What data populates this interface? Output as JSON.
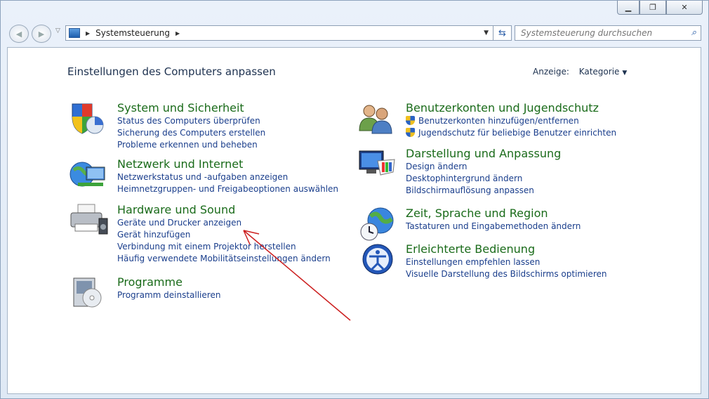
{
  "address": {
    "path_item": "Systemsteuerung"
  },
  "search": {
    "placeholder": "Systemsteuerung durchsuchen"
  },
  "header": {
    "title": "Einstellungen des Computers anpassen",
    "view_label": "Anzeige:",
    "view_value": "Kategorie"
  },
  "categories": [
    {
      "title": "System und Sicherheit",
      "icon": "shield-icon",
      "links": [
        "Status des Computers überprüfen",
        "Sicherung des Computers erstellen",
        "Probleme erkennen und beheben"
      ]
    },
    {
      "title": "Netzwerk und Internet",
      "icon": "network-globe-icon",
      "links": [
        "Netzwerkstatus und -aufgaben anzeigen",
        "Heimnetzgruppen- und Freigabeoptionen auswählen"
      ]
    },
    {
      "title": "Hardware und Sound",
      "icon": "printer-icon",
      "links": [
        "Geräte und Drucker anzeigen",
        "Gerät hinzufügen",
        "Verbindung mit einem Projektor herstellen",
        "Häufig verwendete Mobilitätseinstellungen ändern"
      ]
    },
    {
      "title": "Programme",
      "icon": "software-box-icon",
      "links": [
        "Programm deinstallieren"
      ]
    },
    {
      "title": "Benutzerkonten und Jugendschutz",
      "icon": "users-icon",
      "links": [
        "Benutzerkonten hinzufügen/entfernen",
        "Jugendschutz für beliebige Benutzer einrichten"
      ]
    },
    {
      "title": "Darstellung und Anpassung",
      "icon": "monitor-palette-icon",
      "links": [
        "Design ändern",
        "Desktophintergrund ändern",
        "Bildschirmauflösung anpassen"
      ]
    },
    {
      "title": "Zeit, Sprache und Region",
      "icon": "globe-clock-icon",
      "links": [
        "Tastaturen und Eingabemethoden ändern"
      ]
    },
    {
      "title": "Erleichterte Bedienung",
      "icon": "accessibility-icon",
      "links": [
        "Einstellungen empfehlen lassen",
        "Visuelle Darstellung des Bildschirms optimieren"
      ]
    }
  ],
  "colors": {
    "category_title": "#1a6b1a",
    "link": "#1a3e8c",
    "annotation_arrow": "#cc1f1f"
  }
}
